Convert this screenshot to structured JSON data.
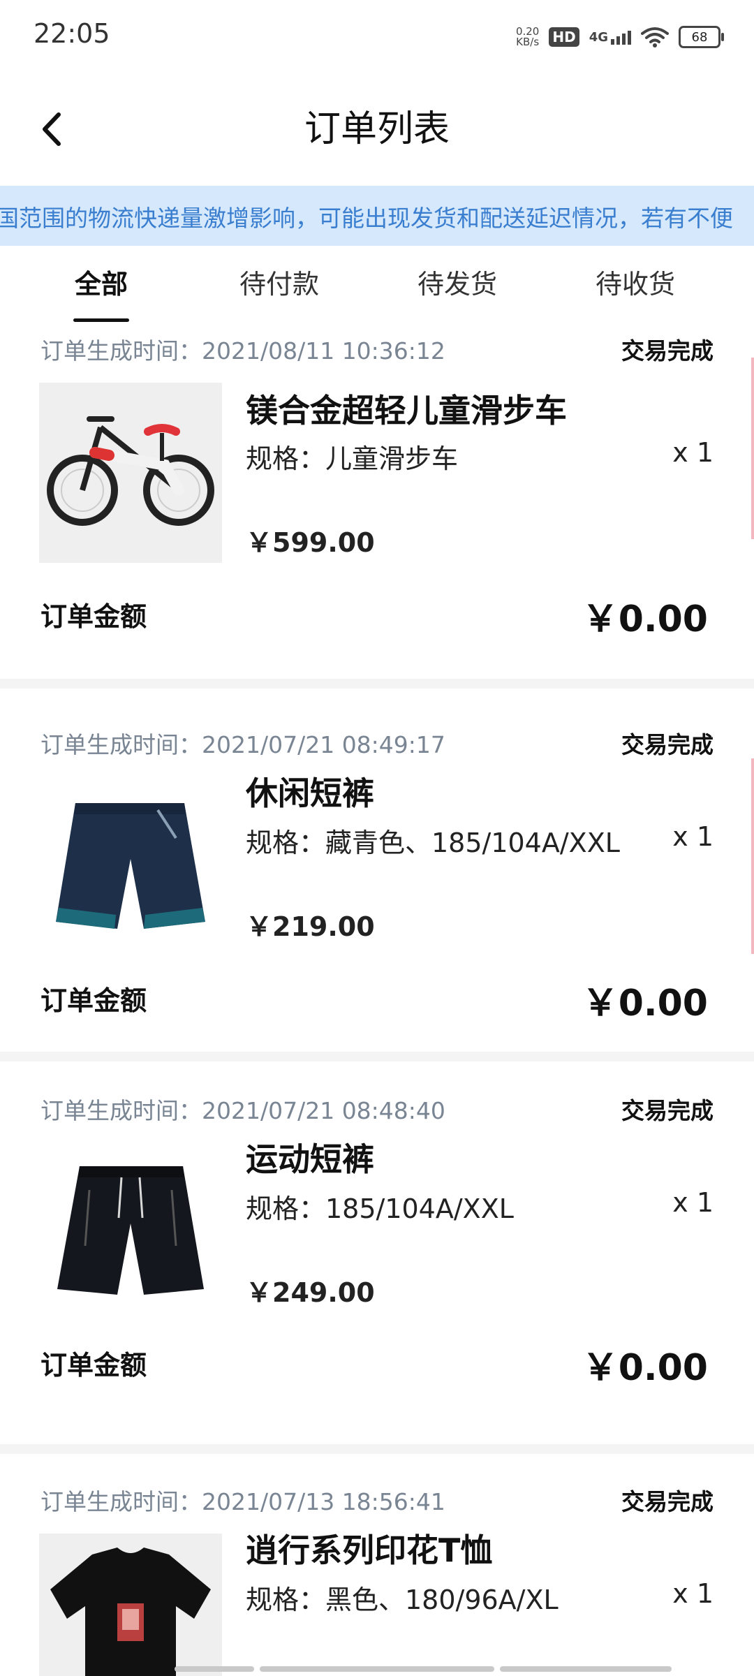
{
  "status_bar": {
    "time": "22:05",
    "speed_value": "0.20",
    "speed_unit": "KB/s",
    "hd": "HD",
    "network": "4G",
    "battery": "68",
    "icons": [
      "hd-icon",
      "signal-icon",
      "wifi-icon",
      "battery-icon"
    ]
  },
  "header": {
    "title": "订单列表",
    "back_icon": "chevron-left-icon"
  },
  "notice": {
    "text": "国范围的物流快递量激增影响，可能出现发货和配送延迟情况，若有不便"
  },
  "tabs": [
    {
      "label": "全部",
      "active": true
    },
    {
      "label": "待付款",
      "active": false
    },
    {
      "label": "待发货",
      "active": false
    },
    {
      "label": "待收货",
      "active": false
    }
  ],
  "orders": [
    {
      "time_label": "订单生成时间：",
      "time": "2021/08/11 10:36:12",
      "status": "交易完成",
      "product_name": "镁合金超轻儿童滑步车",
      "spec": "规格：儿童滑步车",
      "qty": "x 1",
      "price": "￥599.00",
      "amount_label": "订单金额",
      "amount": "￥0.00",
      "image": "balance-bike-image"
    },
    {
      "time_label": "订单生成时间：",
      "time": "2021/07/21 08:49:17",
      "status": "交易完成",
      "product_name": "休闲短裤",
      "spec": "规格：藏青色、185/104A/XXL",
      "qty": "x 1",
      "price": "￥219.00",
      "amount_label": "订单金额",
      "amount": "￥0.00",
      "image": "navy-shorts-image"
    },
    {
      "time_label": "订单生成时间：",
      "time": "2021/07/21 08:48:40",
      "status": "交易完成",
      "product_name": "运动短裤",
      "spec": "规格：185/104A/XXL",
      "qty": "x 1",
      "price": "￥249.00",
      "amount_label": "订单金额",
      "amount": "￥0.00",
      "image": "black-shorts-image"
    },
    {
      "time_label": "订单生成时间：",
      "time": "2021/07/13 18:56:41",
      "status": "交易完成",
      "product_name": "逍行系列印花T恤",
      "spec": "规格：黑色、180/96A/XL",
      "qty": "x 1",
      "image": "black-tshirt-image"
    }
  ],
  "colors": {
    "notice_bg": "#d6e8fb",
    "notice_text": "#3a7ed0",
    "muted_text": "#7a8594",
    "divider": "#f4f4f4"
  }
}
